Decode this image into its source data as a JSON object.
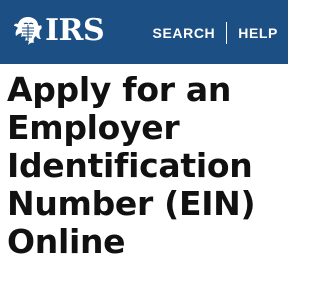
{
  "header": {
    "logo_text": "IRS",
    "logo_icon": "irs-eagle-icon",
    "background_color": "#1c4f83",
    "nav": {
      "search_label": "SEARCH",
      "help_label": "HELP"
    }
  },
  "main": {
    "title": "Apply for an Employer Identification Number (EIN) Online"
  }
}
